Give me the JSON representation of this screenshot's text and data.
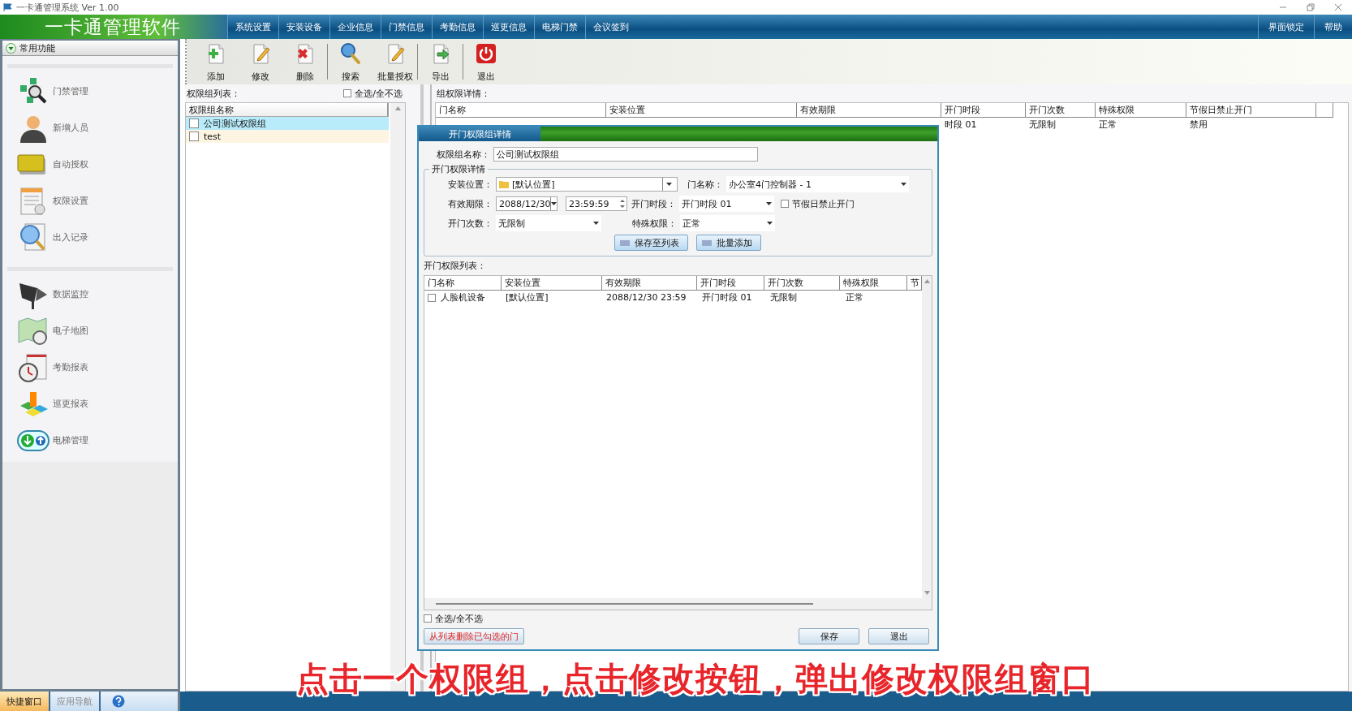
{
  "window": {
    "title": "一卡通管理系统  Ver 1.00"
  },
  "header": {
    "app_name": "一卡通管理软件",
    "menu": [
      "系统设置",
      "安装设备",
      "企业信息",
      "门禁信息",
      "考勤信息",
      "巡更信息",
      "电梯门禁",
      "会议签到"
    ],
    "menu_right": [
      "界面锁定",
      "帮助"
    ]
  },
  "sidebar": {
    "title": "常用功能",
    "groups": [
      {
        "items": [
          "门禁管理",
          "新增人员",
          "自动授权",
          "权限设置",
          "出入记录"
        ]
      },
      {
        "items": [
          "数据监控",
          "电子地图",
          "考勤报表",
          "巡更报表",
          "电梯管理"
        ]
      }
    ]
  },
  "toolbar": {
    "groups": [
      [
        "添加",
        "修改",
        "删除"
      ],
      [
        "搜索",
        "批量授权"
      ],
      [
        "导出"
      ],
      [
        "退出"
      ]
    ]
  },
  "group_list": {
    "label": "权限组列表：",
    "select_all": {
      "label": "全选/全不选",
      "checked": false
    },
    "column": "权限组名称",
    "rows": [
      {
        "name": "公司测试权限组",
        "checked": false,
        "selected": true
      },
      {
        "name": "test",
        "checked": false,
        "selected": false
      }
    ]
  },
  "group_detail": {
    "label": "组权限详情：",
    "columns": [
      "门名称",
      "安装位置",
      "有效期限",
      "开门时段",
      "开门次数",
      "特殊权限",
      "节假日禁止开门"
    ],
    "rows": [
      {
        "cells": [
          "",
          "",
          "",
          "时段 01",
          "无限制",
          "正常",
          "禁用"
        ]
      }
    ]
  },
  "dialog": {
    "title": "开门权限组详情",
    "name_label": "权限组名称：",
    "name_value": "公司测试权限组",
    "fieldset_title": "开门权限详情",
    "location": {
      "label": "安装位置：",
      "value": "[默认位置]"
    },
    "door": {
      "label": "门名称：",
      "value": "办公室4门控制器 - 1"
    },
    "validity": {
      "label": "有效期限：",
      "date": "2088/12/30",
      "time": "23:59:59"
    },
    "period": {
      "label": "开门时段：",
      "value": "开门时段 01"
    },
    "holiday": {
      "label": "节假日禁止开门",
      "checked": false
    },
    "count": {
      "label": "开门次数：",
      "value": "无限制"
    },
    "special": {
      "label": "特殊权限：",
      "value": "正常"
    },
    "buttons": [
      "保存至列表",
      "批量添加"
    ],
    "list_label": "开门权限列表：",
    "columns": [
      "门名称",
      "安装位置",
      "有效期限",
      "开门时段",
      "开门次数",
      "特殊权限",
      "节"
    ],
    "rows": [
      {
        "checked": false,
        "cells": [
          "人脸机设备",
          "[默认位置]",
          "2088/12/30 23:59",
          "开门时段 01",
          "无限制",
          "正常"
        ]
      }
    ],
    "select_all": {
      "label": "全选/全不选",
      "checked": false
    },
    "delete_button": "从列表删除已勾选的门",
    "save_button": "保存",
    "exit_button": "退出"
  },
  "bottom_tabs": [
    {
      "label": "快捷窗口",
      "selected": true
    },
    {
      "label": "应用导航",
      "selected": false
    }
  ],
  "caption": "点击一个权限组，点击修改按钮，弹出修改权限组窗口"
}
